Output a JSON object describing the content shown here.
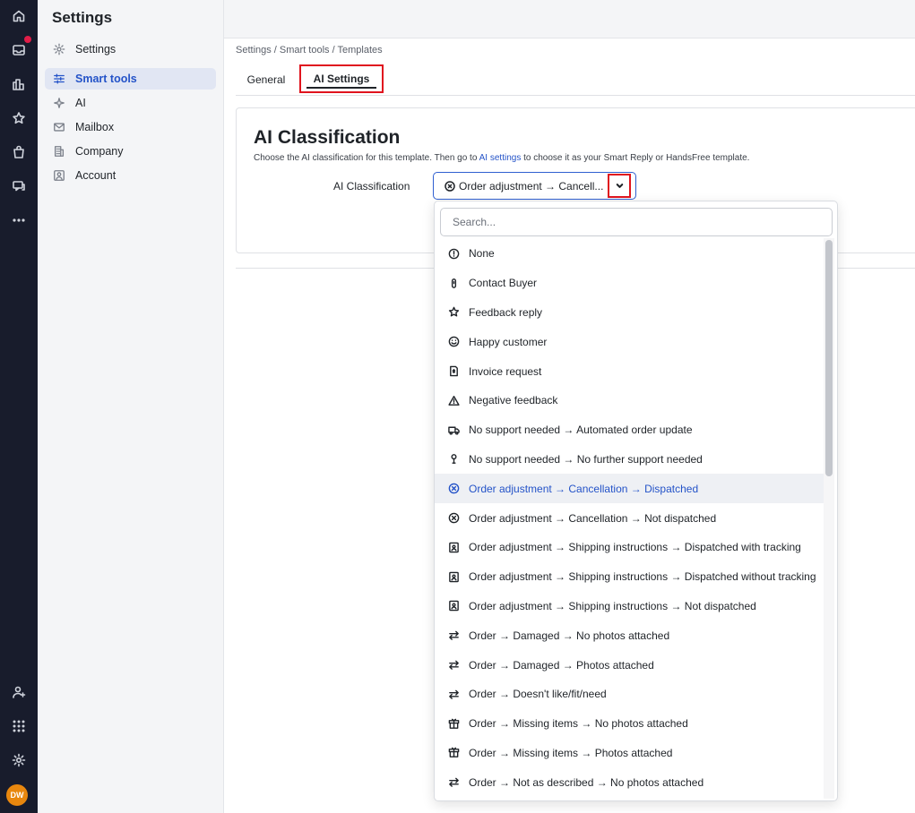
{
  "app": {
    "avatar_initials": "DW"
  },
  "rail": {
    "icons": [
      "home-icon",
      "inbox-icon",
      "analytics-icon",
      "star-icon",
      "orders-icon",
      "chat-icon",
      "more-icon",
      "add-user-icon",
      "apps-grid-icon",
      "settings-icon"
    ]
  },
  "sidebar": {
    "title": "Settings",
    "items": [
      {
        "label": "Settings",
        "icon": "gear-icon"
      },
      {
        "label": "Smart tools",
        "icon": "sliders-icon",
        "active": true
      },
      {
        "label": "AI",
        "icon": "sparkle-icon"
      },
      {
        "label": "Mailbox",
        "icon": "mail-icon"
      },
      {
        "label": "Company",
        "icon": "building-icon"
      },
      {
        "label": "Account",
        "icon": "account-icon"
      }
    ]
  },
  "breadcrumb": "Settings / Smart tools / Templates",
  "tabs": [
    {
      "label": "General"
    },
    {
      "label": "AI Settings",
      "active": true
    }
  ],
  "card": {
    "title": "AI Classification",
    "desc_before": "Choose the AI classification for this template. Then go to ",
    "desc_link": "AI settings",
    "desc_after": " to choose it as your Smart Reply or HandsFree template.",
    "field_label": "AI Classification",
    "selected_value": "Order adjustment → Cancell..."
  },
  "dropdown": {
    "search_placeholder": "Search...",
    "options": [
      {
        "label": "None",
        "icon": "info-icon"
      },
      {
        "label": "Contact Buyer",
        "icon": "contact-icon"
      },
      {
        "label": "Feedback reply",
        "icon": "star-icon"
      },
      {
        "label": "Happy customer",
        "icon": "smile-icon"
      },
      {
        "label": "Invoice request",
        "icon": "invoice-icon"
      },
      {
        "label": "Negative feedback",
        "icon": "warning-icon"
      },
      {
        "label": "No support needed → Automated order update",
        "icon": "truck-icon"
      },
      {
        "label": "No support needed → No further support needed",
        "icon": "hand-icon"
      },
      {
        "label": "Order adjustment → Cancellation → Dispatched",
        "icon": "cancel-circle-icon",
        "selected": true
      },
      {
        "label": "Order adjustment → Cancellation → Not dispatched",
        "icon": "cancel-circle-icon"
      },
      {
        "label": "Order adjustment → Shipping instructions → Dispatched with tracking",
        "icon": "shipping-icon"
      },
      {
        "label": "Order adjustment → Shipping instructions → Dispatched without tracking",
        "icon": "shipping-icon"
      },
      {
        "label": "Order adjustment → Shipping instructions → Not dispatched",
        "icon": "shipping-icon"
      },
      {
        "label": "Order → Damaged → No photos attached",
        "icon": "exchange-icon"
      },
      {
        "label": "Order → Damaged → Photos attached",
        "icon": "exchange-icon"
      },
      {
        "label": "Order → Doesn't like/fit/need",
        "icon": "exchange-icon"
      },
      {
        "label": "Order → Missing items → No photos attached",
        "icon": "package-icon"
      },
      {
        "label": "Order → Missing items → Photos attached",
        "icon": "package-icon"
      },
      {
        "label": "Order → Not as described → No photos attached",
        "icon": "exchange-icon"
      }
    ]
  }
}
